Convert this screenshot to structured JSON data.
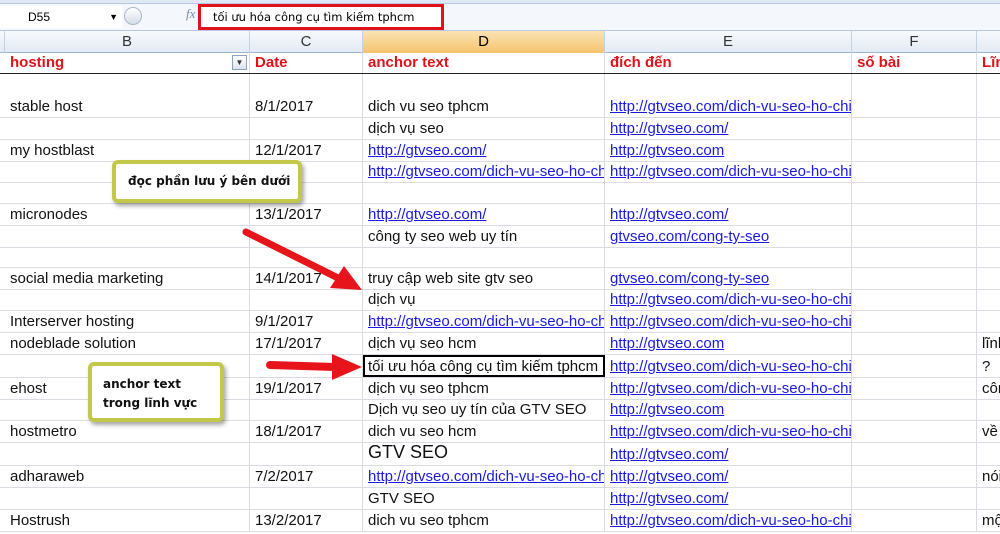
{
  "formula_bar": {
    "name_box": "D55",
    "fx": "fx",
    "value": "tối ưu hóa công cụ tìm kiếm tphcm"
  },
  "columns": [
    {
      "letter": "B"
    },
    {
      "letter": "C"
    },
    {
      "letter": "D",
      "selected": true
    },
    {
      "letter": "E"
    },
    {
      "letter": "F"
    },
    {
      "letter": ""
    }
  ],
  "header": [
    "hosting",
    "Date",
    "anchor text",
    "đích đến",
    "số bài",
    "Lĩn"
  ],
  "rows": [
    [
      "stable host",
      "8/1/2017",
      "dich vu seo tphcm",
      "http://gtvseo.com/dich-vu-seo-ho-chi-minh/",
      "",
      ""
    ],
    [
      "",
      "",
      "dịch vụ seo",
      "http://gtvseo.com/",
      "",
      ""
    ],
    [
      "my hostblast",
      "12/1/2017",
      "http://gtvseo.com/",
      "http://gtvseo.com ",
      "",
      ""
    ],
    [
      "",
      "",
      "http://gtvseo.com/dich-vu-seo-ho-chi-minh/",
      "http://gtvseo.com/dich-vu-seo-ho-chi-minh/",
      "",
      ""
    ],
    [
      "",
      "",
      "",
      "",
      "",
      ""
    ],
    [
      "micronodes",
      "13/1/2017",
      "http://gtvseo.com/",
      "http://gtvseo.com/",
      "",
      ""
    ],
    [
      "",
      "",
      "công ty seo web uy tín",
      "gtvseo.com/cong-ty-seo",
      "",
      ""
    ],
    [
      "",
      "",
      "",
      "",
      "",
      ""
    ],
    [
      "social media marketing",
      "14/1/2017",
      "truy cập web site gtv seo",
      "gtvseo.com/cong-ty-seo",
      "",
      ""
    ],
    [
      "",
      "",
      "dịch vụ",
      "http://gtvseo.com/dich-vu-seo-ho-chi-minh/",
      "",
      ""
    ],
    [
      "Interserver hosting",
      "9/1/2017",
      "http://gtvseo.com/dich-vu-seo-ho-chi-minh/",
      "http://gtvseo.com/dich-vu-seo-ho-chi-minh/",
      "",
      ""
    ],
    [
      "nodeblade solution",
      "17/1/2017",
      "dịch vụ seo hcm",
      "http://gtvseo.com",
      "",
      "lĩnh"
    ],
    [
      "",
      "",
      "tối ưu hóa công cụ tìm kiếm tphcm",
      "http://gtvseo.com/dich-vu-seo-ho-chi-minh/",
      "",
      "?"
    ],
    [
      "ehost",
      "19/1/2017",
      "dịch vụ seo tphcm",
      "http://gtvseo.com/dich-vu-seo-ho-chi-minh/",
      "",
      "côn"
    ],
    [
      "",
      "",
      "Dịch vụ seo uy tín của GTV SEO",
      "http://gtvseo.com",
      "",
      ""
    ],
    [
      "hostmetro",
      "18/1/2017",
      "dich vu seo hcm",
      "http://gtvseo.com/dich-vu-seo-ho-chi-minh/",
      "",
      "về"
    ],
    [
      "",
      "",
      "GTV SEO",
      "http://gtvseo.com/",
      "",
      ""
    ],
    [
      "adharaweb",
      "7/2/2017",
      "http://gtvseo.com/dich-vu-seo-ho-chi-minh/",
      "http://gtvseo.com/",
      "",
      "nói"
    ],
    [
      "",
      "",
      "GTV SEO",
      "http://gtvseo.com/",
      "",
      ""
    ],
    [
      "Hostrush",
      "13/2/2017",
      "dich vu seo tphcm",
      "http://gtvseo.com/dich-vu-seo-ho-chi-minh/",
      "",
      "mộ"
    ]
  ],
  "callouts": {
    "note1": "đọc phần lưu ý bên dưới",
    "note2_line1": "anchor text",
    "note2_line2": "trong lĩnh vực"
  },
  "colors": {
    "header_text": "#e0121b",
    "link": "#1a1ae0",
    "highlight_border": "#e0121b",
    "callout_border": "#c3c84a",
    "arrow": "#e8141c"
  }
}
